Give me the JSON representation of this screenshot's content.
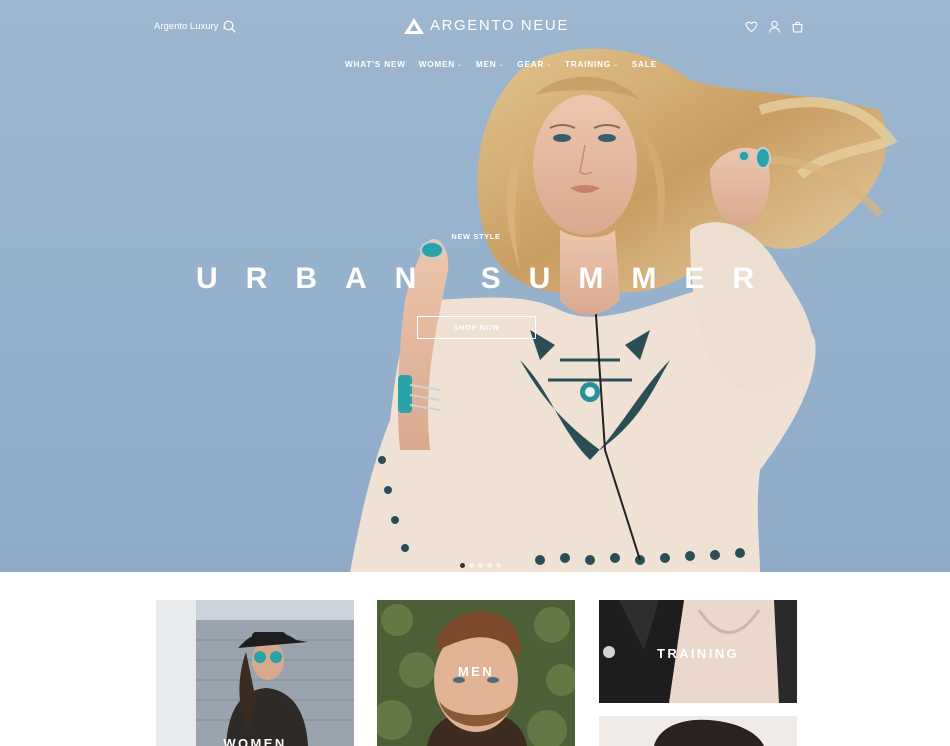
{
  "header": {
    "store_selector": "Argento Luxury",
    "brand": "ARGENTO NEUE"
  },
  "nav": [
    {
      "label": "WHAT'S NEW",
      "has_dropdown": false
    },
    {
      "label": "WOMEN",
      "has_dropdown": true
    },
    {
      "label": "MEN",
      "has_dropdown": true
    },
    {
      "label": "GEAR",
      "has_dropdown": true
    },
    {
      "label": "TRAINING",
      "has_dropdown": true
    },
    {
      "label": "SALE",
      "has_dropdown": false
    }
  ],
  "hero": {
    "eyebrow": "NEW STYLE",
    "headline": "URBAN SUMMER",
    "cta": "SHOP NOW",
    "slides_total": 5,
    "active_slide": 1
  },
  "categories": {
    "women": "WOMEN",
    "men": "MEN",
    "training": "TRAINING"
  },
  "icons": {
    "search": "search-icon",
    "wishlist": "heart-icon",
    "account": "user-icon",
    "cart": "bag-icon"
  },
  "colors": {
    "sky": "#97b2cd",
    "text_light": "#ffffff",
    "active_dot": "#333333"
  }
}
